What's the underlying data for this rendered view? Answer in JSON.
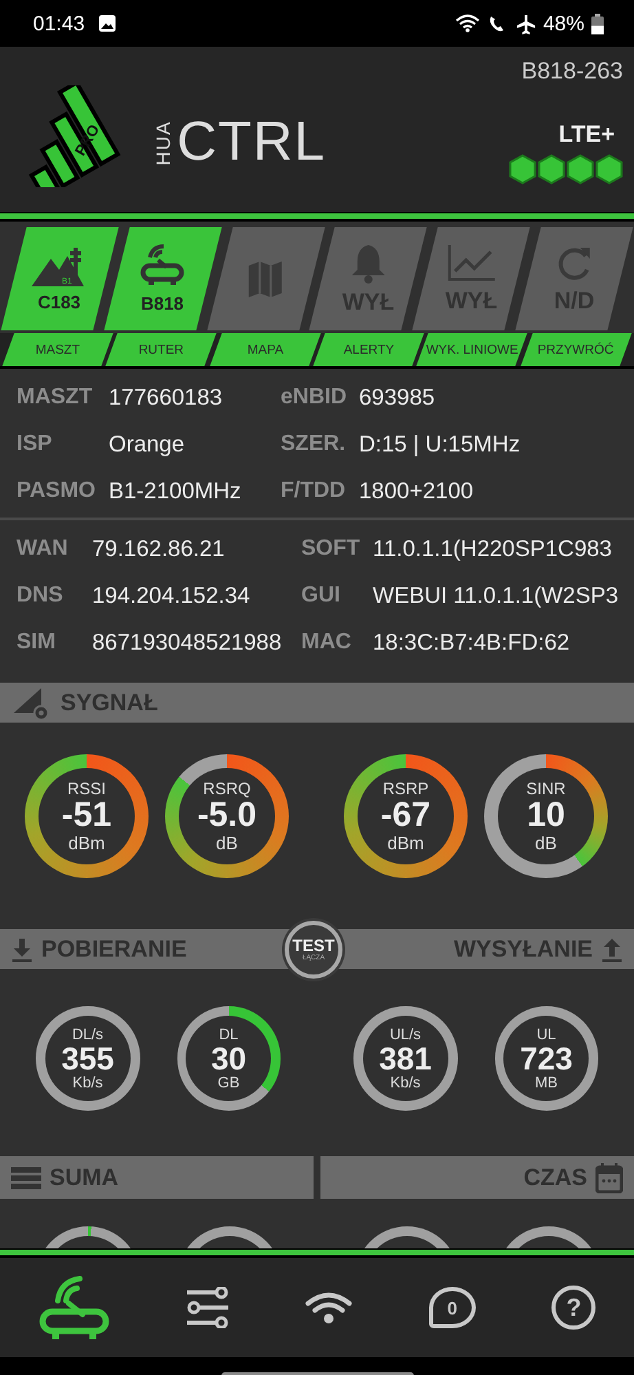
{
  "status_bar": {
    "time": "01:43",
    "battery": "48%"
  },
  "header": {
    "device": "B818-263",
    "logo_badge": "PRO",
    "brand_prefix": "HUA",
    "brand": "CTRL",
    "network": "LTE+",
    "signal_hexes": [
      {
        "on": true
      },
      {
        "on": true
      },
      {
        "on": true
      },
      {
        "on": true
      }
    ]
  },
  "tiles": [
    {
      "kind": "mast",
      "icon_text": "B1",
      "value": "C183",
      "label": "MASZT",
      "active": true
    },
    {
      "kind": "router",
      "value": "B818",
      "label": "RUTER",
      "active": true
    },
    {
      "kind": "map",
      "label": "MAPA",
      "active": false
    },
    {
      "kind": "bell",
      "value": "WYŁ",
      "label": "ALERTY",
      "active": false
    },
    {
      "kind": "chart",
      "value": "WYŁ",
      "label": "WYK. LINIOWE",
      "active": false
    },
    {
      "kind": "refresh",
      "value": "N/D",
      "label": "PRZYWRÓĆ",
      "active": false
    }
  ],
  "info_groups": [
    [
      [
        {
          "label": "MASZT",
          "value": "177660183"
        },
        {
          "label": "eNBID",
          "value": "693985"
        }
      ],
      [
        {
          "label": "ISP",
          "value": "Orange"
        },
        {
          "label": "SZER.",
          "value": "D:15 | U:15MHz"
        }
      ],
      [
        {
          "label": "PASMO",
          "value": "B1-2100MHz"
        },
        {
          "label": "F/TDD",
          "value": "1800+2100"
        }
      ]
    ],
    [
      [
        {
          "label": "WAN",
          "value": "79.162.86.21"
        },
        {
          "label": "SOFT",
          "value": "11.0.1.1(H220SP1C983"
        }
      ],
      [
        {
          "label": "DNS",
          "value": "194.204.152.34"
        },
        {
          "label": "GUI",
          "value": "WEBUI 11.0.1.1(W2SP3"
        }
      ],
      [
        {
          "label": "SIM",
          "value": "867193048521988"
        },
        {
          "label": "MAC",
          "value": "18:3C:B7:4B:FD:62"
        }
      ]
    ]
  ],
  "signal": {
    "title": "SYGNAŁ",
    "gauges": [
      {
        "label": "RSSI",
        "value": "-51",
        "unit": "dBm"
      },
      {
        "label": "RSRQ",
        "value": "-5.0",
        "unit": "dB"
      },
      {
        "label": "RSRP",
        "value": "-67",
        "unit": "dBm"
      },
      {
        "label": "SINR",
        "value": "10",
        "unit": "dB"
      }
    ]
  },
  "transfer": {
    "download_title": "POBIERANIE",
    "upload_title": "WYSYŁANIE",
    "test_button": {
      "label": "TEST",
      "sublabel": "ŁĄCZA"
    },
    "gauges": [
      {
        "label": "DL/s",
        "value": "355",
        "unit": "Kb/s"
      },
      {
        "label": "DL",
        "value": "30",
        "unit": "GB"
      },
      {
        "label": "UL/s",
        "value": "381",
        "unit": "Kb/s"
      },
      {
        "label": "UL",
        "value": "723",
        "unit": "MB"
      }
    ]
  },
  "totals": {
    "left_title": "SUMA",
    "right_title": "CZAS"
  },
  "bottom_nav": [
    {
      "kind": "router",
      "selected": true
    },
    {
      "kind": "settings",
      "selected": false
    },
    {
      "kind": "wifi",
      "selected": false
    },
    {
      "kind": "messages",
      "badge": "0",
      "selected": false
    },
    {
      "kind": "help",
      "glyph": "?",
      "selected": false
    }
  ]
}
